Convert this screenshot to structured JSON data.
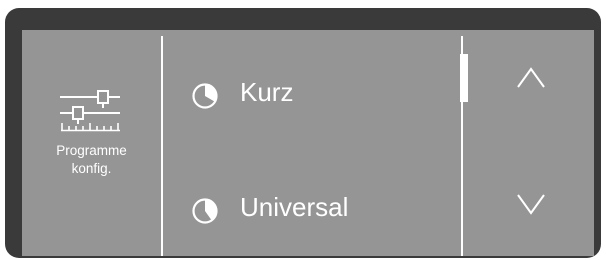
{
  "sidebar": {
    "icon": "settings-sliders-icon",
    "label_line1": "Programme",
    "label_line2": "konfig."
  },
  "program_list": {
    "items": [
      {
        "label": "Kurz",
        "icon": "pie-quarter-clock-icon"
      },
      {
        "label": "Universal",
        "icon": "pie-half-clock-icon"
      }
    ],
    "scroll_position": 0
  },
  "navigation": {
    "up_icon": "chevron-up-icon",
    "down_icon": "chevron-down-icon"
  },
  "colors": {
    "screen": "#959595",
    "bezel": "#3a3a3a",
    "foreground": "#ffffff"
  }
}
